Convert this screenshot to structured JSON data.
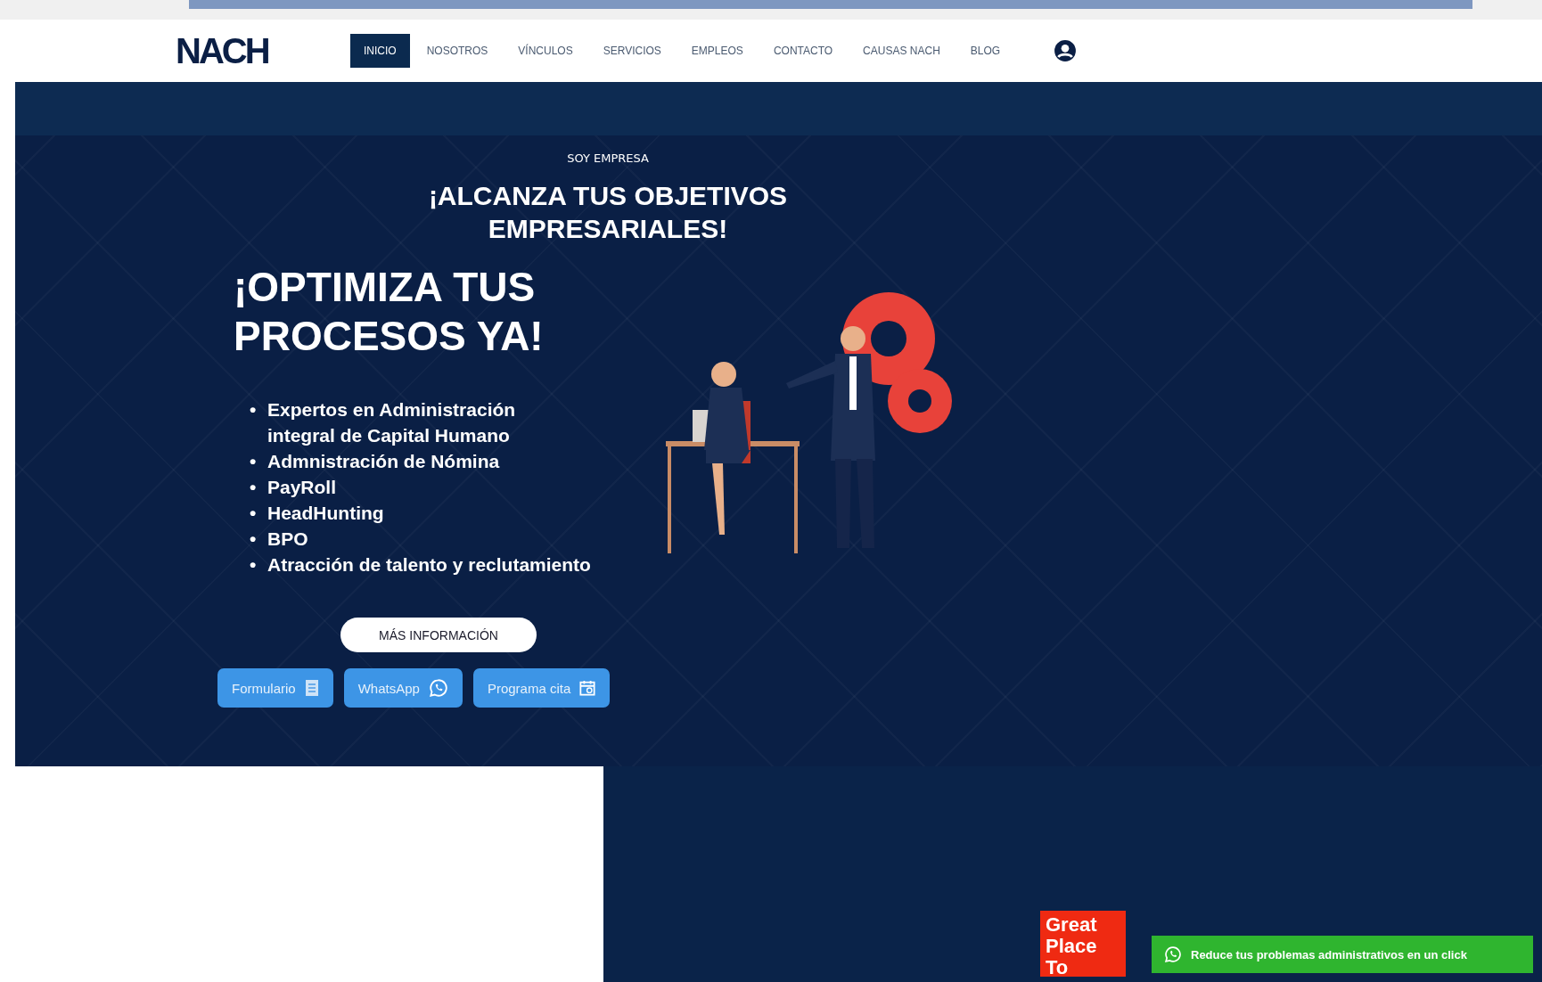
{
  "nav": {
    "logo": "NACH",
    "items": [
      {
        "label": "INICIO",
        "selected": true
      },
      {
        "label": "NOSOTROS",
        "selected": false
      },
      {
        "label": "VÍNCULOS",
        "selected": false
      },
      {
        "label": "SERVICIOS",
        "selected": false
      },
      {
        "label": "EMPLEOS",
        "selected": false
      },
      {
        "label": "CONTACTO",
        "selected": false
      },
      {
        "label": "CAUSAS NACH",
        "selected": false
      },
      {
        "label": "BLOG",
        "selected": false
      }
    ]
  },
  "hero": {
    "eyebrow": "SOY EMPRESA",
    "headline": "¡ALCANZA TUS OBJETIVOS EMPRESARIALES!",
    "title": "¡OPTIMIZA TUS PROCESOS YA!",
    "bullets": [
      {
        "marker": "•",
        "text": "Expertos en Administración integral de Capital Humano"
      },
      {
        "marker": "•",
        "text": "Admnistración de Nómina"
      },
      {
        "marker": "•",
        "text": "PayRoll"
      },
      {
        "marker": "•",
        "text": "HeadHunting"
      },
      {
        "marker": "•",
        "text": "BPO"
      },
      {
        "marker": "•",
        "text": "Atracción de talento y reclutamiento"
      }
    ],
    "more_button": "MÁS INFORMACIÓN",
    "contact_buttons": [
      {
        "label": "Formulario",
        "kind": "form"
      },
      {
        "label": "WhatsApp",
        "kind": "whatsapp"
      },
      {
        "label": "Programa cita",
        "kind": "calendar"
      }
    ]
  },
  "badge": "Great Place To",
  "whatsapp_bar": "Reduce tus problemas administrativos en un click"
}
